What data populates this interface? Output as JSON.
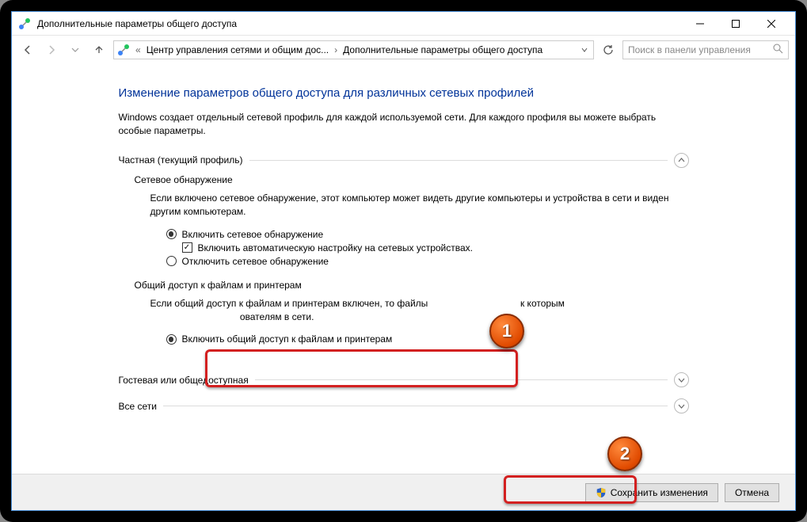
{
  "window": {
    "title": "Дополнительные параметры общего доступа"
  },
  "breadcrumb": {
    "item1": "Центр управления сетями и общим дос...",
    "item2": "Дополнительные параметры общего доступа",
    "chev_left": "«"
  },
  "search": {
    "placeholder": "Поиск в панели управления"
  },
  "page": {
    "heading": "Изменение параметров общего доступа для различных сетевых профилей",
    "intro": "Windows создает отдельный сетевой профиль для каждой используемой сети. Для каждого профиля вы можете выбрать особые параметры."
  },
  "sections": {
    "private": {
      "title": "Частная (текущий профиль)",
      "discovery": {
        "title": "Сетевое обнаружение",
        "desc": "Если включено сетевое обнаружение, этот компьютер может видеть другие компьютеры и устройства в сети и виден другим компьютерам.",
        "opt_on": "Включить сетевое обнаружение",
        "opt_auto": "Включить автоматическую настройку на сетевых устройствах.",
        "opt_off": "Отключить сетевое обнаружение"
      },
      "fileshare": {
        "title": "Общий доступ к файлам и принтерам",
        "desc_a": "Если общий доступ к файлам и принтерам включен, то файлы",
        "desc_b": "к которым",
        "opt_on": "Включить общий доступ к файлам и принтерам",
        "desc_gap": "                                  ователям в сети."
      }
    },
    "guest": {
      "title": "Гостевая или общедоступная"
    },
    "all": {
      "title": "Все сети"
    }
  },
  "footer": {
    "save": "Сохранить изменения",
    "cancel": "Отмена"
  },
  "callouts": {
    "c1": "1",
    "c2": "2"
  }
}
